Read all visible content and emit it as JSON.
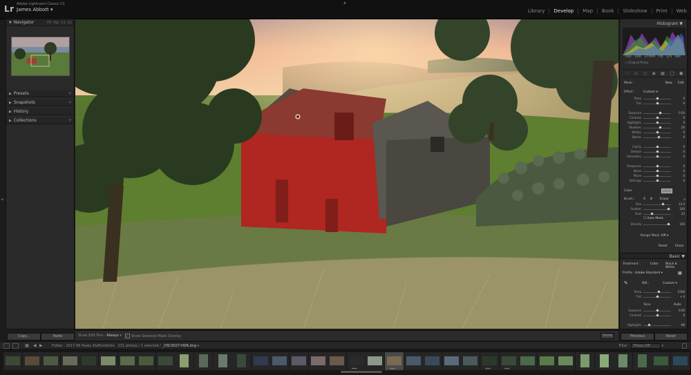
{
  "app": {
    "logo": "Lr",
    "product": "Adobe Lightroom Classic CC",
    "user": "James Abbott",
    "modules": [
      "Library",
      "Develop",
      "Map",
      "Book",
      "Slideshow",
      "Print",
      "Web"
    ],
    "active_module": "Develop"
  },
  "left_panel": {
    "navigator": {
      "title": "Navigator",
      "zoom_options": [
        "FIT",
        "FILL",
        "1:1",
        "3:1"
      ]
    },
    "sections": [
      "Presets",
      "Snapshots",
      "History",
      "Collections"
    ],
    "copy_label": "Copy...",
    "paste_label": "Paste"
  },
  "toolbar": {
    "show_edit_pins_label": "Show Edit Pins :",
    "show_edit_pins_value": "Always",
    "overlay_label": "Show Selected Mask Overlay",
    "overlay_checked": true,
    "done_label": "Done"
  },
  "right_panel": {
    "histogram_title": "Histogram",
    "histogram_values": [
      "ISO 100",
      "17mm",
      "f/8",
      "1/5 sec"
    ],
    "original_photo_label": "Original Photo",
    "mask_row": {
      "label": "Mask :",
      "new": "New",
      "edit": "Edit"
    },
    "effect": {
      "label": "Effect :",
      "value": "Custom"
    },
    "sliders": [
      {
        "label": "Temp",
        "pos": 0.5,
        "value": "0"
      },
      {
        "label": "Tint",
        "pos": 0.5,
        "value": "0"
      },
      {
        "label": "Exposure",
        "pos": 0.6,
        "value": "0.50"
      },
      {
        "label": "Contrast",
        "pos": 0.5,
        "value": "0"
      },
      {
        "label": "Highlights",
        "pos": 0.5,
        "value": "0"
      },
      {
        "label": "Shadows",
        "pos": 0.6,
        "value": "20"
      },
      {
        "label": "Whites",
        "pos": 0.5,
        "value": "0"
      },
      {
        "label": "Blacks",
        "pos": 0.55,
        "value": "6"
      },
      {
        "label": "Clarity",
        "pos": 0.5,
        "value": "0"
      },
      {
        "label": "Dehaze",
        "pos": 0.5,
        "value": "0"
      },
      {
        "label": "Saturation",
        "pos": 0.5,
        "value": "0"
      },
      {
        "label": "Sharpness",
        "pos": 0.5,
        "value": "0"
      },
      {
        "label": "Noise",
        "pos": 0.5,
        "value": "0"
      },
      {
        "label": "Moire",
        "pos": 0.5,
        "value": "0"
      },
      {
        "label": "Defringe",
        "pos": 0.5,
        "value": "0"
      }
    ],
    "color_label": "Color",
    "brush": {
      "label": "Brush :",
      "a": "A",
      "b": "B",
      "erase": "Erase",
      "rows": [
        {
          "label": "Size",
          "pos": 0.7,
          "value": "12.0"
        },
        {
          "label": "Feather",
          "pos": 0.9,
          "value": "100"
        },
        {
          "label": "Flow",
          "pos": 0.3,
          "value": "23"
        },
        {
          "label": "Density",
          "pos": 0.9,
          "value": "100"
        }
      ],
      "auto_mask": "Auto Mask"
    },
    "range_mask": {
      "label": "Range Mask :",
      "value": "Off"
    },
    "reset": "Reset",
    "close": "Close",
    "basic": {
      "title": "Basic",
      "treatment_label": "Treatment :",
      "treatment_color": "Color",
      "treatment_bw": "Black & White",
      "profile_label": "Profile :",
      "profile_value": "Adobe Standard",
      "wb_label": "WB :",
      "wb_value": "Custom",
      "rows": [
        {
          "label": "Temp",
          "pos": 0.55,
          "value": "5208"
        },
        {
          "label": "Tint",
          "pos": 0.5,
          "value": "+ 4"
        }
      ],
      "tone_label": "Tone",
      "auto_label": "Auto",
      "tone_rows": [
        {
          "label": "Exposure",
          "pos": 0.5,
          "value": "0.00"
        },
        {
          "label": "Contrast",
          "pos": 0.5,
          "value": "0"
        },
        {
          "label": "Highlights",
          "pos": 0.2,
          "value": "- 88"
        }
      ]
    },
    "previous_label": "Previous",
    "reset_label": "Reset"
  },
  "filmstrip_bar": {
    "info_prefix": "Folder : 2017-06 Peaks Staffordshire",
    "info_count": "231 photos / 1 selected /",
    "file_name": "_DSC0027-HDR.dng",
    "filter_label": "Filter :",
    "filter_value": "Filters Off"
  },
  "filmstrip": {
    "thumbs": [
      {
        "t": "l",
        "c": "#3c4a34"
      },
      {
        "t": "l",
        "c": "#5a4a3a"
      },
      {
        "t": "l",
        "c": "#4c5a44"
      },
      {
        "t": "l",
        "c": "#6a6a5a"
      },
      {
        "t": "l",
        "c": "#2e3a2e"
      },
      {
        "t": "l",
        "c": "#7a8a6a"
      },
      {
        "t": "l",
        "c": "#5a6a4a"
      },
      {
        "t": "l",
        "c": "#4a5a3a"
      },
      {
        "t": "l",
        "c": "#3a4a3a"
      },
      {
        "t": "p",
        "c": "#8aa070"
      },
      {
        "t": "p",
        "c": "#5a6a5a"
      },
      {
        "t": "p",
        "c": "#6a7a6a"
      },
      {
        "t": "p",
        "c": "#3a4a3a"
      },
      {
        "t": "l",
        "c": "#303a50"
      },
      {
        "t": "l",
        "c": "#4a5a6a"
      },
      {
        "t": "l",
        "c": "#5a5a6a"
      },
      {
        "t": "l",
        "c": "#7a6a6a"
      },
      {
        "t": "l",
        "c": "#6a5a4a"
      },
      {
        "t": "l",
        "c": "#2a2a2a",
        "d": "*****"
      },
      {
        "t": "l",
        "c": "#8a9a8a"
      },
      {
        "t": "l",
        "c": "#7a6a50",
        "sel": true,
        "d": "*****"
      },
      {
        "t": "l",
        "c": "#4a5a6a"
      },
      {
        "t": "l",
        "c": "#3a4a5a"
      },
      {
        "t": "l",
        "c": "#5a6a7a"
      },
      {
        "t": "l",
        "c": "#4a5a5a"
      },
      {
        "t": "l",
        "c": "#2a3a2a",
        "d": "*****"
      },
      {
        "t": "l",
        "c": "#3a4a3a",
        "d": "*****"
      },
      {
        "t": "l",
        "c": "#4a6a4a"
      },
      {
        "t": "l",
        "c": "#5a7a4a"
      },
      {
        "t": "l",
        "c": "#6a8a5a"
      },
      {
        "t": "p",
        "c": "#7a9a6a"
      },
      {
        "t": "p",
        "c": "#8aaa7a"
      },
      {
        "t": "p",
        "c": "#6a8a6a"
      },
      {
        "t": "p",
        "c": "#4a6a4a"
      },
      {
        "t": "l",
        "c": "#3a5a3a"
      },
      {
        "t": "l",
        "c": "#2a4a5a"
      }
    ]
  }
}
